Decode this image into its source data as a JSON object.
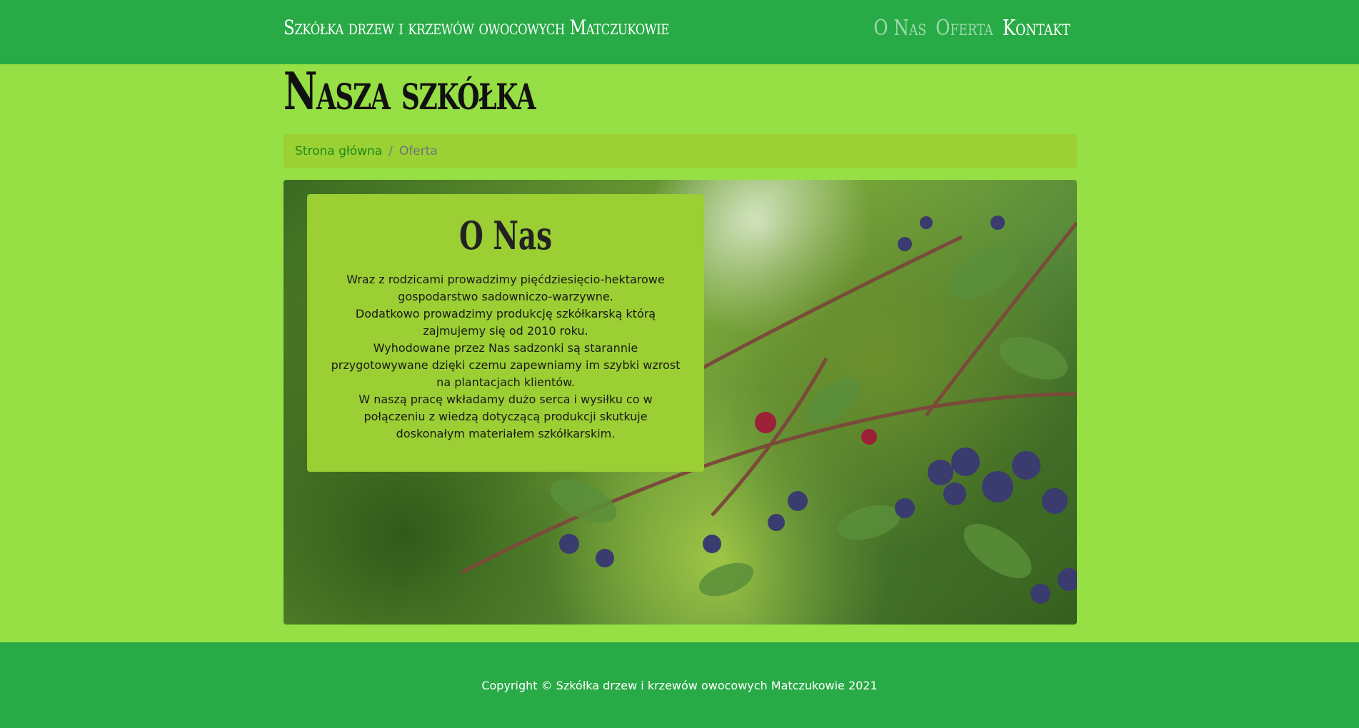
{
  "header": {
    "brand": "Szkółka drzew i krzewów owocowych Matczukowie",
    "nav": [
      {
        "label": "O Nas",
        "active": false
      },
      {
        "label": "Oferta",
        "active": false
      },
      {
        "label": "Kontakt",
        "active": true
      }
    ]
  },
  "main": {
    "title": "Nasza szkółka",
    "breadcrumb": {
      "home": "Strona główna",
      "separator": "/",
      "current": "Oferta"
    },
    "about": {
      "title": "O Nas",
      "paragraphs": [
        "Wraz z rodzicami prowadzimy pięćdziesięcio-hektarowe gospodarstwo sadowniczo-warzywne.",
        "Dodatkowo prowadzimy produkcję szkółkarską którą zajmujemy się od 2010 roku.",
        "Wyhodowane przez Nas sadzonki są starannie przygotowywane dzięki czemu zapewniamy im szybki wzrost na plantacjach klientów.",
        "W naszą pracę wkładamy dużo serca i wysiłku co w połączeniu z wiedzą dotyczącą produkcji skutkuje doskonałym materiałem szkółkarskim."
      ]
    }
  },
  "footer": {
    "copyright": "Copyright © Szkółka drzew i krzewów owocowych Matczukowie 2021"
  },
  "colors": {
    "navbar": "#28aa46",
    "page_bg": "#96df44",
    "card_bg": "#9bcf33",
    "breadcrumb_bg": "#9bd132"
  }
}
